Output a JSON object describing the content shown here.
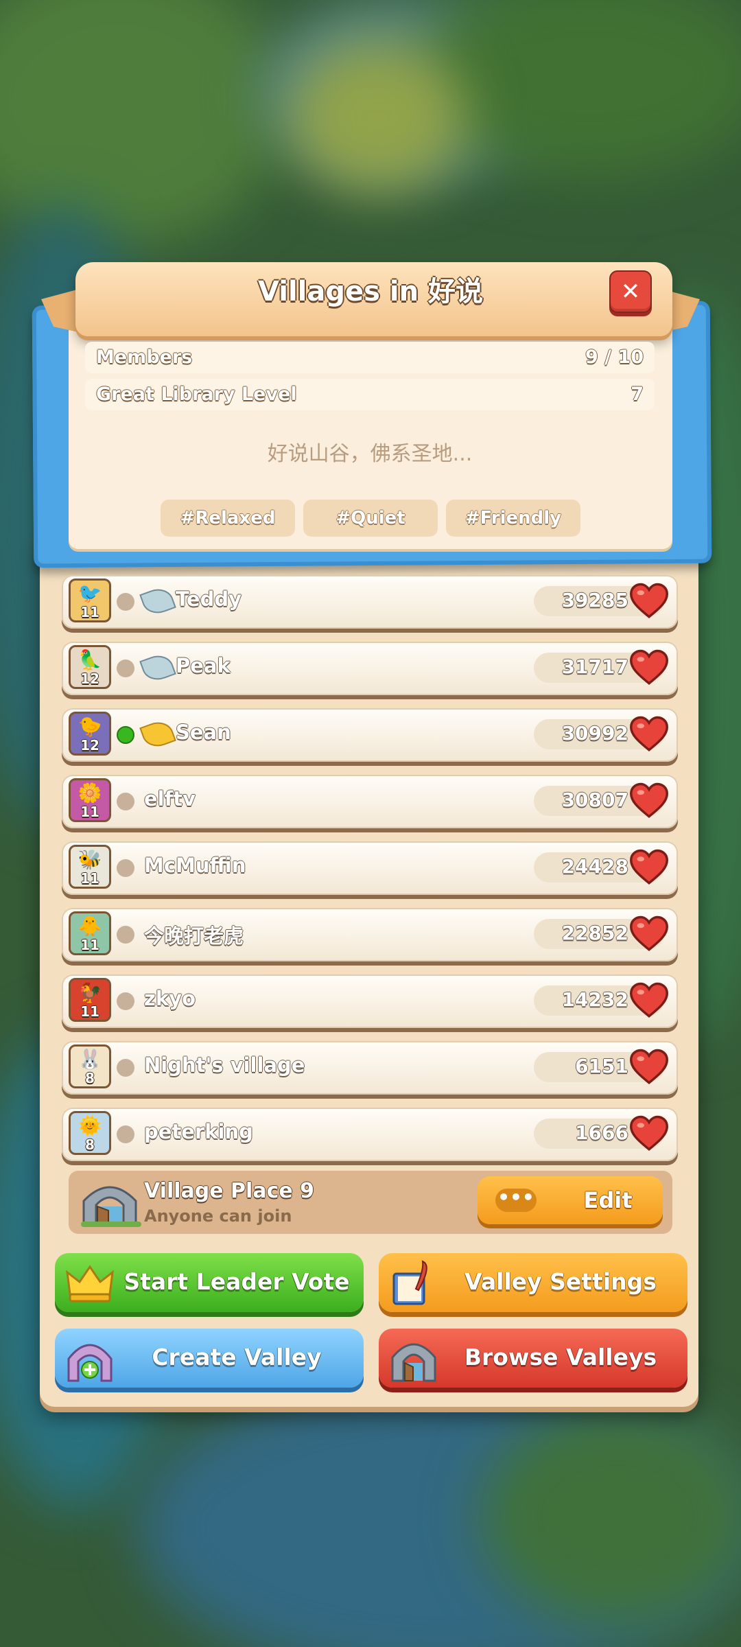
{
  "header": {
    "title": "Villages in 好说",
    "close_label": "✕"
  },
  "stats": {
    "members_label": "Members",
    "members_value": "9 / 10",
    "library_label": "Great Library Level",
    "library_value": "7"
  },
  "description": "好说山谷，佛系圣地...",
  "tags": [
    "#Relaxed",
    "#Quiet",
    "#Friendly"
  ],
  "members": [
    {
      "level": "11",
      "name": "Teddy",
      "score": "39285",
      "online": false,
      "badge": "silver-leaf-icon",
      "avatar_icon": "red-bird-icon"
    },
    {
      "level": "12",
      "name": "Peak",
      "score": "31717",
      "online": false,
      "badge": "silver-leaf-icon",
      "avatar_icon": "parrot-icon"
    },
    {
      "level": "12",
      "name": "Sean",
      "score": "30992",
      "online": true,
      "badge": "gold-leaf-icon",
      "avatar_icon": "blue-bird-icon"
    },
    {
      "level": "11",
      "name": "elftv",
      "score": "30807",
      "online": false,
      "badge": "",
      "avatar_icon": "flower-icon"
    },
    {
      "level": "11",
      "name": "McMuffin",
      "score": "24428",
      "online": false,
      "badge": "",
      "avatar_icon": "bee-icon"
    },
    {
      "level": "11",
      "name": "今晚打老虎",
      "score": "22852",
      "online": false,
      "badge": "",
      "avatar_icon": "bird-icon"
    },
    {
      "level": "11",
      "name": "zkyo",
      "score": "14232",
      "online": false,
      "badge": "",
      "avatar_icon": "chicken-icon"
    },
    {
      "level": "8",
      "name": "Night's village",
      "score": "6151",
      "online": false,
      "badge": "",
      "avatar_icon": "rabbit-icon"
    },
    {
      "level": "8",
      "name": "peterking",
      "score": "1666",
      "online": false,
      "badge": "",
      "avatar_icon": "sun-icon"
    }
  ],
  "village_place": {
    "title": "Village Place 9",
    "subtitle": "Anyone can join",
    "dots_label": "•••",
    "edit_label": "Edit"
  },
  "actions": {
    "start_vote": "Start Leader Vote",
    "valley_settings": "Valley Settings",
    "create_valley": "Create Valley",
    "browse_valleys": "Browse Valleys"
  },
  "colors": {
    "panel": "#f4dfc0",
    "header_blue": "#4fa6e6",
    "close_red": "#e64a3c",
    "online_green": "#39b71f",
    "heart_red": "#e8433a"
  }
}
